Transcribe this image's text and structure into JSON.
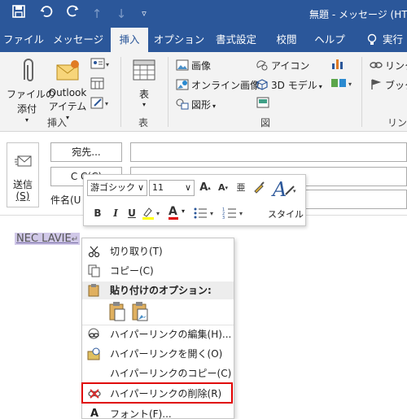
{
  "quick_access": {
    "save_icon": "save-icon",
    "undo_icon": "undo-icon",
    "redo_icon": "redo-icon",
    "up_icon": "arrow-up-icon",
    "down_icon": "arrow-down-icon",
    "customize_icon": "customize-icon"
  },
  "window_title": "無題 - メッセージ (HTN",
  "tabs": [
    {
      "label": "ファイル"
    },
    {
      "label": "メッセージ"
    },
    {
      "label": "挿入"
    },
    {
      "label": "オプション"
    },
    {
      "label": "書式設定"
    },
    {
      "label": "校閲"
    },
    {
      "label": "ヘルプ"
    },
    {
      "label": "実行"
    }
  ],
  "ribbon": {
    "include_group": {
      "attach_file_line1": "ファイルの",
      "attach_file_line2": "添付",
      "outlook_item_line1": "Outlook",
      "outlook_item_line2": "アイテム",
      "label": "挿入"
    },
    "table_group": {
      "table_label": "表",
      "label": "表"
    },
    "illustrations_group": {
      "picture": "画像",
      "online_picture": "オンライン画像",
      "shapes": "図形",
      "icons": "アイコン",
      "models_3d": "3D モデル",
      "label": "図"
    },
    "links_group": {
      "link": "リンク",
      "bookmark": "ブックマ",
      "label": "リンク"
    }
  },
  "compose": {
    "send_label": "送信",
    "send_key": "(S)",
    "to_button": "宛先...",
    "cc_button": "C C(C)",
    "subject_label": "件名(U"
  },
  "body": {
    "link_text": "NEC LAVIE",
    "paragraph_mark": "↵"
  },
  "mini_toolbar": {
    "font_name": "游ゴシック",
    "font_size": "11",
    "grow_font": "A",
    "shrink_font": "A",
    "phonetic": "亜",
    "bold": "B",
    "italic": "I",
    "underline": "U",
    "font_color_letter": "A",
    "styles_label": "スタイル"
  },
  "context_menu": {
    "cut": "切り取り(T)",
    "copy": "コピー(C)",
    "paste_options_header": "貼り付けのオプション:",
    "edit_hyperlink": "ハイパーリンクの編集(H)...",
    "open_hyperlink": "ハイパーリンクを開く(O)",
    "copy_hyperlink": "ハイパーリンクのコピー(C)",
    "remove_hyperlink": "ハイパーリンクの削除(R)",
    "font": "フォント(F)..."
  },
  "colors": {
    "accent": "#2b579a",
    "highlight": "#e00000",
    "text_highlight": "#ffff00",
    "font_color": "#e00000"
  }
}
